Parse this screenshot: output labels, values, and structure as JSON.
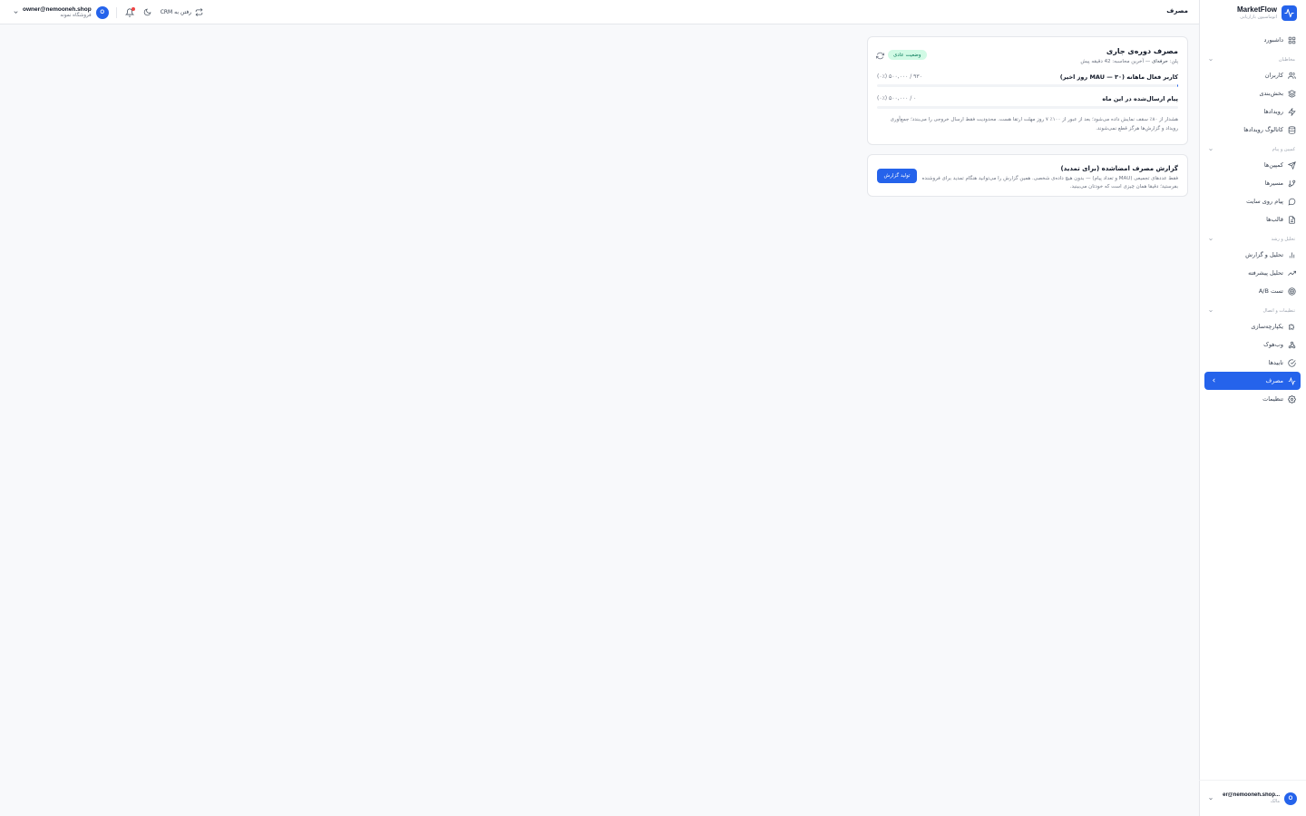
{
  "brand": {
    "name": "MarketFlow",
    "subtitle": "اتوماسیون بازاریابی"
  },
  "sidebar": {
    "dashboard": "داشبورد",
    "groups": [
      {
        "label": "مخاطبان",
        "items": [
          "کاربران",
          "بخش‌بندی",
          "رویدادها",
          "کاتالوگ رویدادها"
        ]
      },
      {
        "label": "کمپین و پیام",
        "items": [
          "کمپین‌ها",
          "مسیرها",
          "پیام روی سایت",
          "قالب‌ها"
        ]
      },
      {
        "label": "تحلیل و رشد",
        "items": [
          "تحلیل و گزارش",
          "تحلیل پیشرفته",
          "تست A/B"
        ]
      },
      {
        "label": "تنظیمات و اتصال",
        "items": [
          "یکپارچه‌سازی",
          "وب‌هوک",
          "تاییدها",
          "مصرف",
          "تنظیمات"
        ]
      }
    ],
    "active_item": "مصرف",
    "user": {
      "initial": "O",
      "email": "...er@nemooneh.shop",
      "role": "مالک"
    }
  },
  "topbar": {
    "page_title": "مصرف",
    "crm_link": "رفتن به CRM",
    "user": {
      "initial": "O",
      "email": "owner@nemooneh.shop",
      "store": "فروشگاه نمونه"
    }
  },
  "usage_card": {
    "title": "مصرف دوره‌ی جاری",
    "meta_plan_label": "پلن:",
    "meta_plan_value": "حرفه‌ای",
    "meta_rest": "— آخرین محاسبه: 42 دقیقه پیش",
    "status": "وضعیت عادی",
    "mau": {
      "label": "کاربر فعال ماهانه (MAU — ۳۰ روز اخیر)",
      "value": "۹۳۰ / ۵۰۰,۰۰۰ (۰٪)",
      "percent": 0.186
    },
    "messages": {
      "label": "پیام ارسال‌شده در این ماه",
      "value": "۰ / ۵۰۰,۰۰۰ (۰٪)",
      "percent": 0
    },
    "warning": "هشدار از ۸۰٪ سقف نمایش داده می‌شود؛ بعد از عبور از ۱۰۰٪ ۷ روز مهلت ارتقا هست. محدودیت فقط ارسال خروجی را می‌بندد؛ جمع‌آوری رویداد و گزارش‌ها هرگز قطع نمی‌شوند."
  },
  "report_card": {
    "title": "گزارش مصرف امضاشده (برای تمدید)",
    "description": "فقط عددهای تجمیعی (MAU و تعداد پیام) — بدون هیچ داده‌ی شخصی. همین گزارش را می‌توانید هنگام تمدید برای فروشنده بفرستید؛ دقیقا همان چیزی است که خودتان می‌بینید.",
    "button": "تولید گزارش"
  },
  "colors": {
    "accent": "#2563eb",
    "status_bg": "#d1fae5",
    "status_text": "#047857",
    "notification": "#ef4444"
  }
}
